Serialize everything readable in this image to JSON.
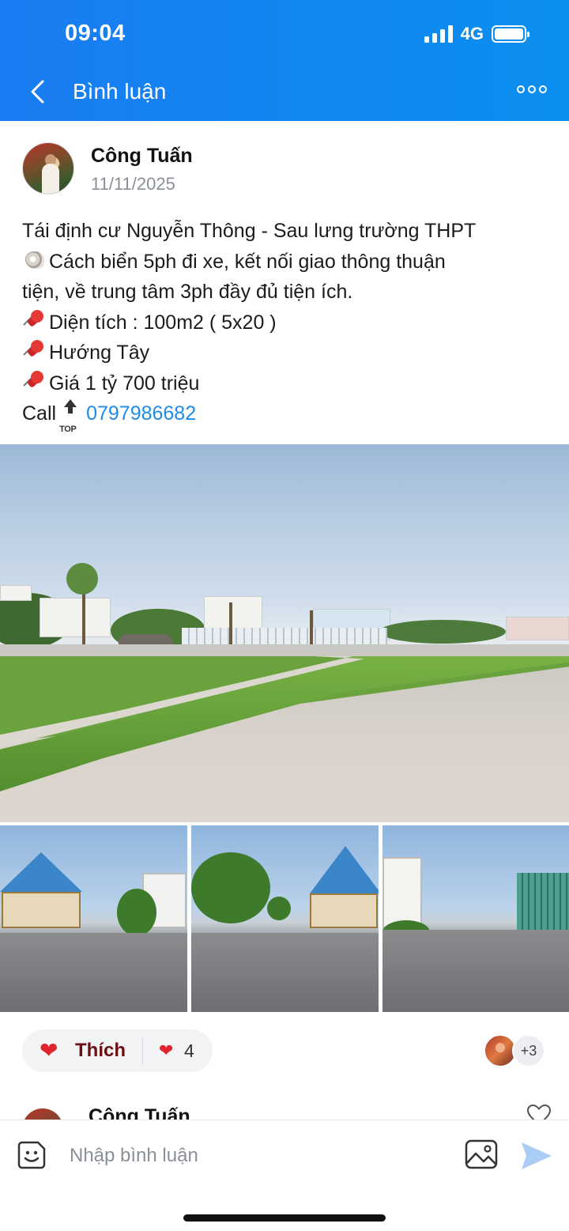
{
  "status_bar": {
    "time": "09:04",
    "network": "4G"
  },
  "header": {
    "title": "Bình luận"
  },
  "post": {
    "author": "Công Tuấn",
    "date": "11/11/2025",
    "lines": {
      "l1": "Tái định cư Nguyễn Thông - Sau lưng trường THPT",
      "l2": "Cách biển 5ph đi xe, kết nối giao thông thuận",
      "l3": "tiện, về trung tâm 3ph đầy đủ tiện ích.",
      "l4": "Diện tích : 100m2 ( 5x20 )",
      "l5": "Hướng Tây",
      "l6": "Giá 1 tỷ 700 triệu",
      "call_label": "Call",
      "top_icon_text": "TOP",
      "phone": "0797986682"
    },
    "icons": {
      "shell": "spiral-shell-icon",
      "pin": "pushpin-icon",
      "top": "top-arrow-icon"
    }
  },
  "reactions": {
    "like_label": "Thích",
    "like_count": "4",
    "more_reactors": "+3"
  },
  "comment_peek": {
    "author": "Công Tuấn"
  },
  "composer": {
    "placeholder": "Nhập bình luận"
  },
  "colors": {
    "header_blue": "#1a7cf2",
    "link_blue": "#1f8be8",
    "like_red": "#e0242e"
  }
}
